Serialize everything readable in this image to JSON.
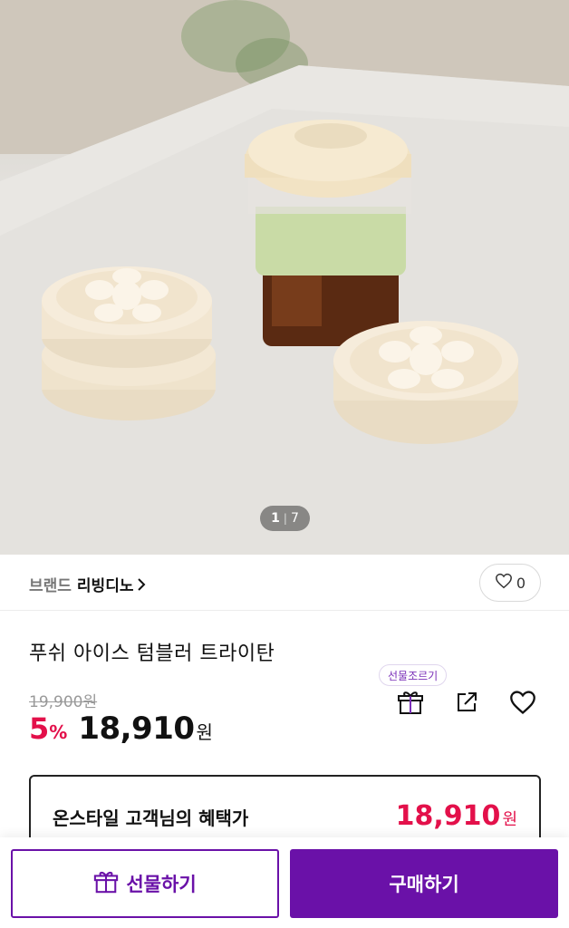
{
  "hero": {
    "image_alt": "",
    "pager": {
      "current": "1",
      "separator": "|",
      "total": "7"
    }
  },
  "brand": {
    "prefix": "브랜드",
    "name": "리빙디노"
  },
  "likes": {
    "count": "0"
  },
  "product": {
    "title": "푸쉬 아이스 텀블러 트라이탄",
    "original_price": "19,900원",
    "discount_number": "5",
    "discount_symbol": "%",
    "sale_price": "18,910",
    "currency": "원"
  },
  "actions": {
    "gift_tooltip": "선물조르기"
  },
  "benefit": {
    "label": "온스타일 고객님의 혜택가",
    "price": "18,910",
    "currency": "원"
  },
  "bottom_bar": {
    "gift_label": "선물하기",
    "buy_label": "구매하기"
  },
  "colors": {
    "accent": "#6a11a8",
    "sale": "#e3104a"
  },
  "icons": [
    "chevron-right-icon",
    "heart-outline-icon",
    "gift-icon",
    "share-icon",
    "heart-icon"
  ]
}
